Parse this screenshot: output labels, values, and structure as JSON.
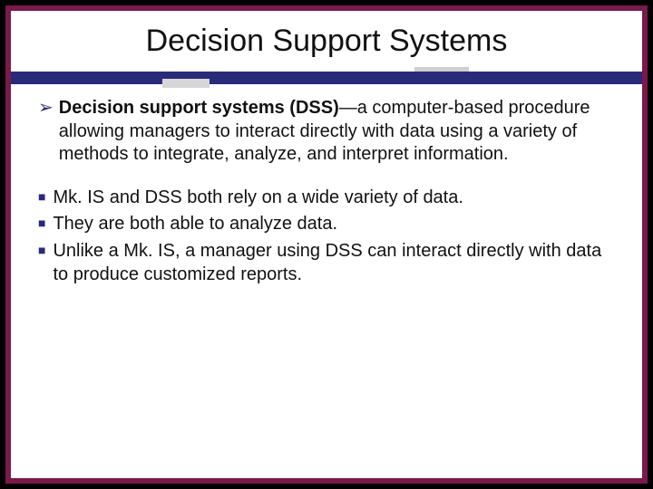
{
  "slide": {
    "title": "Decision Support Systems",
    "bullets_l1": [
      {
        "bold": "Decision support systems (DSS)",
        "rest": "—a computer-based procedure allowing managers to interact directly with data using a variety of methods to integrate, analyze, and interpret information."
      }
    ],
    "bullets_l2": [
      {
        "text": "Mk. IS and DSS both rely on a wide variety of data."
      },
      {
        "text": "They are both able to analyze data."
      },
      {
        "text": "Unlike a Mk. IS, a manager using DSS can interact directly with data to produce customized reports."
      }
    ]
  }
}
